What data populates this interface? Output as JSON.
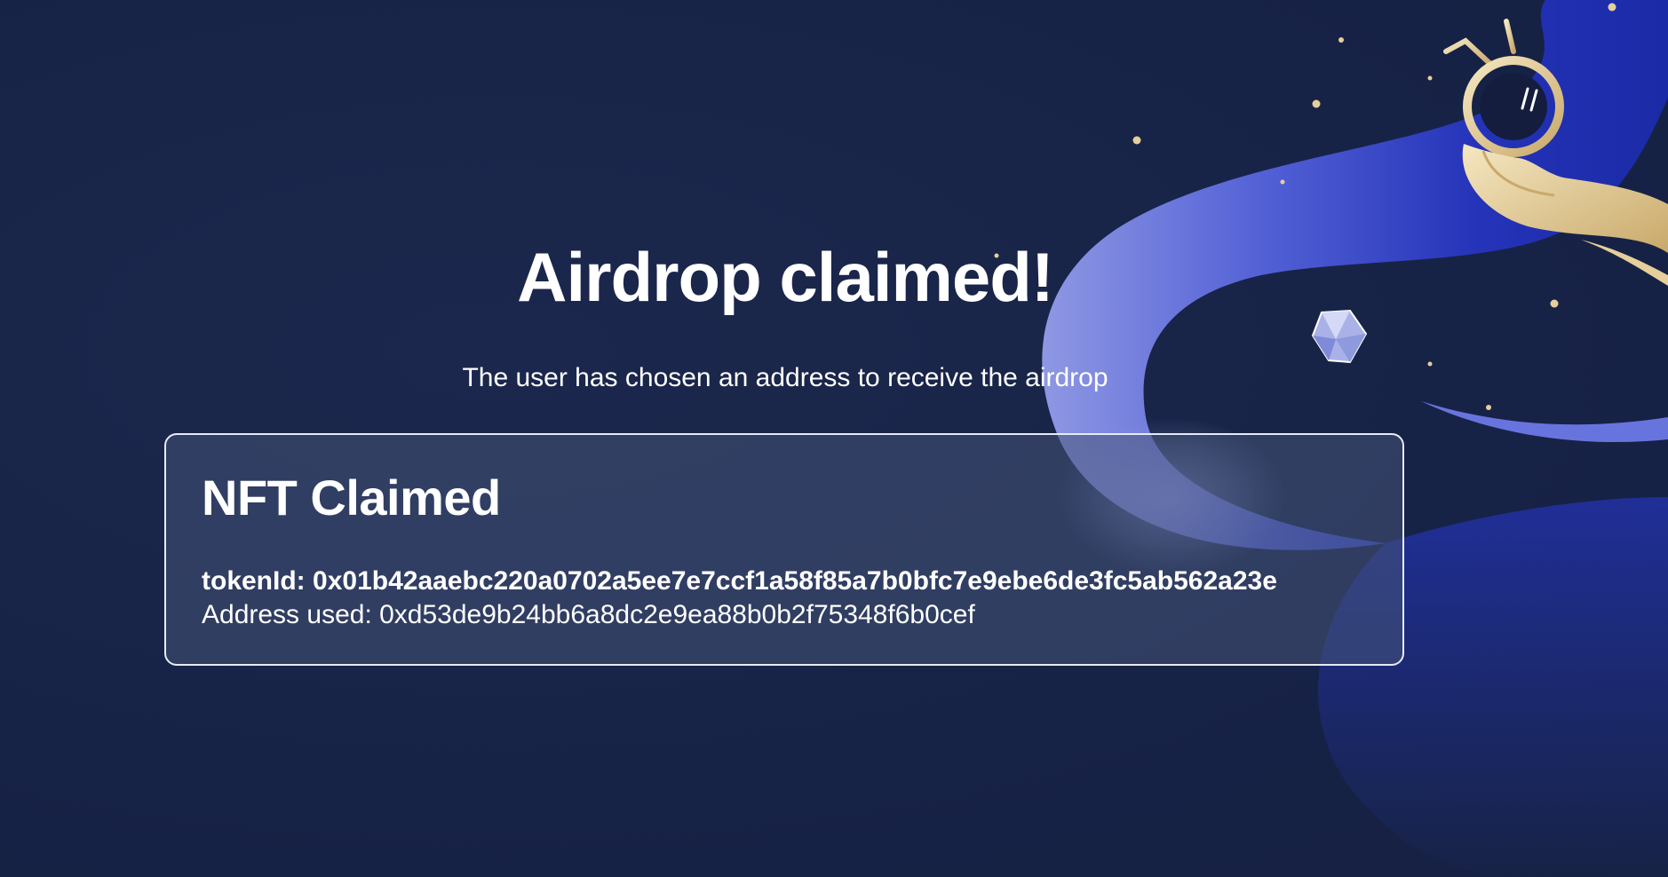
{
  "page": {
    "headline": "Airdrop claimed!",
    "subtitle": "The user has chosen an address to receive the airdrop"
  },
  "card": {
    "title": "NFT Claimed",
    "token_label": "tokenId:",
    "token_value": "0x01b42aaebc220a0702a5ee7e7ccf1a58f85a7b0bfc7e9ebe6de3fc5ab562a23e",
    "address_label": "Address used:",
    "address_value": "0xd53de9b24bb6a8dc2e9ea88b0b2f75348f6b0cef"
  },
  "colors": {
    "background": "#172346",
    "ribbon": "#3a4fd8",
    "ribbon_light": "#8c97e6",
    "card_border": "#e8ebf5",
    "accent_gold": "#e6cf9a"
  },
  "icons": {
    "mascot": "astronaut-hand-illustration",
    "gem": "crystal-gem-icon"
  }
}
